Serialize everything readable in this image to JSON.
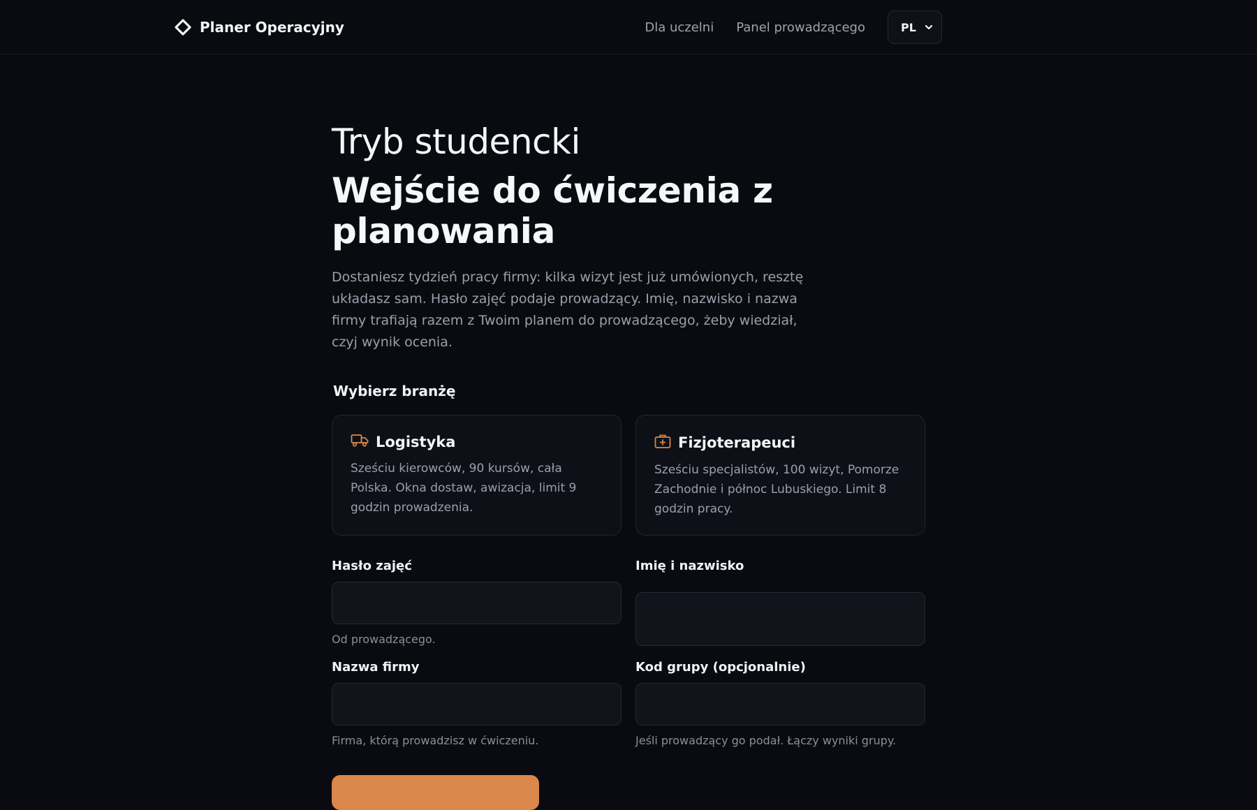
{
  "app": {
    "brand": "Planer Operacyjny"
  },
  "nav": {
    "links": [
      "Dla uczelni",
      "Panel prowadzącego"
    ],
    "language": "PL"
  },
  "hero": {
    "eyebrow": "Tryb studencki",
    "title": "Wejście do ćwiczenia z planowania",
    "lead": "Dostaniesz tydzień pracy firmy: kilka wizyt jest już umówionych, resztę układasz sam. Hasło zajęć podaje prowadzący. Imię, nazwisko i nazwa firmy trafiają razem z Twoim planem do prowadzącego, żeby wiedział, czyj wynik ocenia."
  },
  "industry": {
    "label": "Wybierz branżę",
    "options": [
      {
        "icon": "truck-icon",
        "title": "Logistyka",
        "description": "Sześciu kierowców, 90 kursów, cała Polska. Okna dostaw, awizacja, limit 9 godzin prowadzenia."
      },
      {
        "icon": "medical-kit-icon",
        "title": "Fizjoterapeuci",
        "description": "Sześciu specjalistów, 100 wizyt, Pomorze Zachodnie i północ Lubuskiego. Limit 8 godzin pracy."
      }
    ]
  },
  "form": {
    "class_password": {
      "label": "Hasło zajęć",
      "value": "",
      "hint": "Od prowadzącego."
    },
    "full_name": {
      "label": "Imię i nazwisko",
      "value": ""
    },
    "company_name": {
      "label": "Nazwa firmy",
      "value": "",
      "hint": "Firma, którą prowadzisz w ćwiczeniu."
    },
    "group_code": {
      "label": "Kod grupy (opcjonalnie)",
      "value": "",
      "hint": "Jeśli prowadzący go podał. Łączy wyniki grupy."
    }
  },
  "colors": {
    "background": "#0a0b10",
    "accent": "#d9874a",
    "muted_text": "#9aa0ad"
  }
}
